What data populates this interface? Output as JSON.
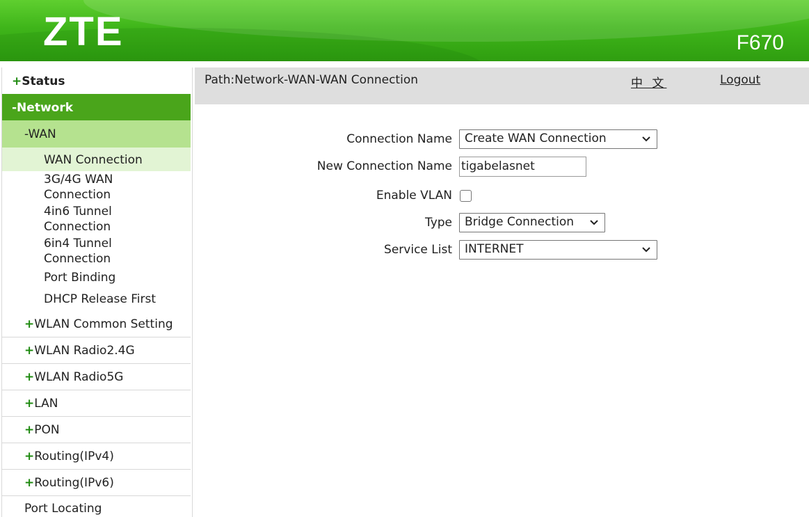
{
  "header": {
    "logo": "ZTE",
    "model": "F670"
  },
  "sidebar": {
    "status": {
      "sign": "+",
      "label": "Status"
    },
    "network": {
      "label": "-Network"
    },
    "wan": {
      "label": "-WAN"
    },
    "wan_items": [
      {
        "line1": "WAN Connection"
      },
      {
        "line1": "3G/4G WAN",
        "line2": "Connection"
      },
      {
        "line1": "4in6 Tunnel",
        "line2": "Connection"
      },
      {
        "line1": "6in4 Tunnel",
        "line2": "Connection"
      },
      {
        "line1": "Port Binding"
      },
      {
        "line1": "DHCP Release First"
      }
    ],
    "groups": [
      {
        "sign": "+",
        "label": "WLAN Common Setting"
      },
      {
        "sign": "+",
        "label": "WLAN Radio2.4G"
      },
      {
        "sign": "+",
        "label": "WLAN Radio5G"
      },
      {
        "sign": "+",
        "label": "LAN"
      },
      {
        "sign": "+",
        "label": "PON"
      },
      {
        "sign": "+",
        "label": "Routing(IPv4)"
      },
      {
        "sign": "+",
        "label": "Routing(IPv6)"
      },
      {
        "sign": "",
        "label": "Port Locating"
      }
    ]
  },
  "pathbar": {
    "path": "Path:Network-WAN-WAN Connection",
    "language": "中 文",
    "logout": "Logout"
  },
  "form": {
    "connection_name": {
      "label": "Connection Name",
      "value": "Create WAN Connection"
    },
    "new_connection_name": {
      "label": "New Connection Name",
      "value": "tigabelasnet"
    },
    "enable_vlan": {
      "label": "Enable VLAN",
      "checked": false
    },
    "type": {
      "label": "Type",
      "value": "Bridge Connection"
    },
    "service_list": {
      "label": "Service List",
      "value": "INTERNET"
    }
  },
  "colors": {
    "header_green": "#3fb51a",
    "network_active_bg": "#4aa51b",
    "wan_bg": "#b5e28f",
    "active_leaf_bg": "#e2f4d4",
    "pathbar_bg": "#dedede",
    "plus_green": "#1f8a10"
  }
}
